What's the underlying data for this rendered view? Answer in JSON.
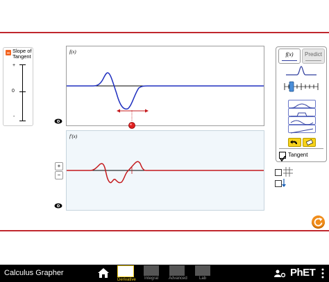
{
  "slope_panel": {
    "title": "Slope of Tangent",
    "labels": {
      "top": "+",
      "middle": "0",
      "bottom": "-"
    }
  },
  "graphs": {
    "top": {
      "curve_label": "f(x)"
    },
    "bottom": {
      "curve_label": "f′(x)"
    }
  },
  "zoom": {
    "in_label": "+",
    "out_label": "−"
  },
  "control_panel": {
    "tabs": [
      {
        "label": "f(x)",
        "selected": true
      },
      {
        "label": "Predict",
        "selected": false
      }
    ],
    "shape_buttons": [
      "hills",
      "triangle",
      "pedestal",
      "trapezoid",
      "sinusoid",
      "parabola",
      "line"
    ],
    "tangent_label": "Tangent",
    "tangent_checked": true
  },
  "side_checks": {
    "grid_checked": false,
    "reference_line_checked": false
  },
  "colors": {
    "curve": "#1f2fbf",
    "derivative": "#c4191c",
    "accent": "#f7d21a",
    "reset": "#f08c1a",
    "divider": "#c0272d"
  },
  "navbar": {
    "title": "Calculus Grapher",
    "screens": [
      {
        "label": "Derivative",
        "selected": true
      },
      {
        "label": "Integral",
        "selected": false
      },
      {
        "label": "Advanced",
        "selected": false
      },
      {
        "label": "Lab",
        "selected": false
      }
    ],
    "brand": "PhET"
  }
}
